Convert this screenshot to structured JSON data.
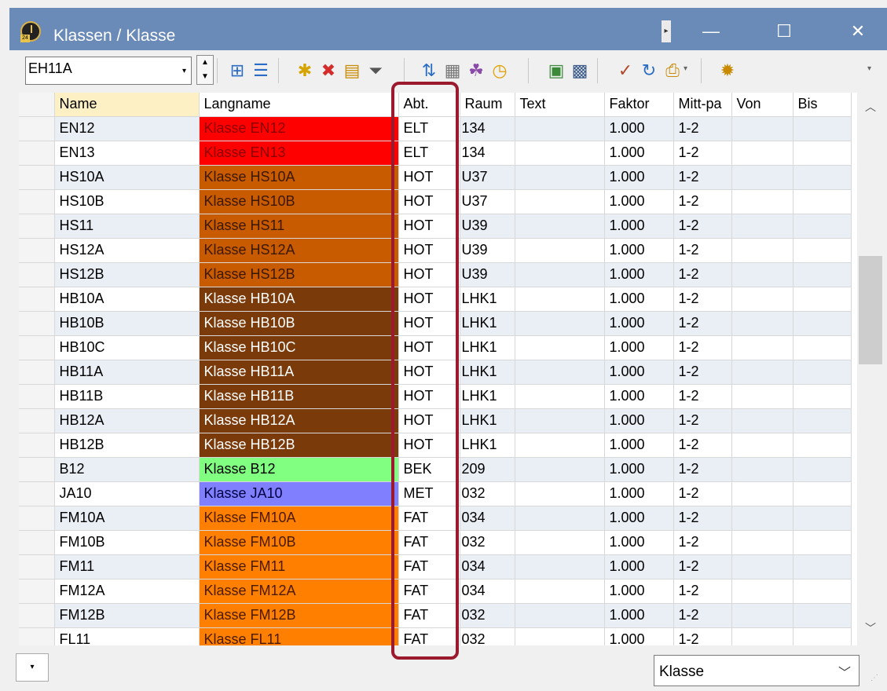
{
  "window": {
    "title": "Klassen / Klasse",
    "pin_glyph": "▸",
    "minimize_glyph": "—",
    "maximize_glyph": "☐",
    "close_glyph": "✕"
  },
  "toolbar": {
    "class_selector_value": "EH11A",
    "combo_arrow": "▾",
    "spin_up": "▲",
    "spin_down": "▼",
    "icons": [
      {
        "name": "grid-settings-icon",
        "glyph": "⊞",
        "color": "#2b6cc4"
      },
      {
        "name": "list-view-icon",
        "glyph": "☰",
        "color": "#2b6cc4"
      },
      {
        "name": "new-record-icon",
        "glyph": "✱",
        "color": "#d6a400"
      },
      {
        "name": "delete-icon",
        "glyph": "✖",
        "color": "#d42b2b"
      },
      {
        "name": "report-icon",
        "glyph": "▤",
        "color": "#c98a00"
      },
      {
        "name": "filter-icon",
        "glyph": "⏷",
        "color": "#555555"
      },
      {
        "name": "sort-icon",
        "glyph": "⇅",
        "color": "#2b6cc4"
      },
      {
        "name": "field-layout-icon",
        "glyph": "▦",
        "color": "#777777"
      },
      {
        "name": "teams-icon",
        "glyph": "☘",
        "color": "#8a4aa8"
      },
      {
        "name": "time-request-icon",
        "glyph": "◷",
        "color": "#e0a000"
      },
      {
        "name": "copy-icon",
        "glyph": "▣",
        "color": "#3a8a3a"
      },
      {
        "name": "calendar-icon",
        "glyph": "▩",
        "color": "#3a5a8a"
      },
      {
        "name": "plan-check-icon",
        "glyph": "✓",
        "color": "#b04a2a"
      },
      {
        "name": "refresh-icon",
        "glyph": "↻",
        "color": "#2b6cc4"
      },
      {
        "name": "print-settings-icon",
        "glyph": "⎙",
        "color": "#c98a00"
      },
      {
        "name": "settings-icon",
        "glyph": "✹",
        "color": "#c98a00"
      }
    ],
    "overflow_glyph": "▾"
  },
  "grid": {
    "columns": [
      "Name",
      "Langname",
      "Abt.",
      "Raum",
      "Text",
      "Faktor",
      "Mitt-pa",
      "Von",
      "Bis"
    ],
    "rows": [
      {
        "name": "EN12",
        "langname": "Klasse EN12",
        "color": "#ff0000",
        "text_color": "#8a0000",
        "abt": "ELT",
        "raum": "134",
        "text": "",
        "faktor": "1.000",
        "mittpa": "1-2",
        "von": "",
        "bis": ""
      },
      {
        "name": "EN13",
        "langname": "Klasse EN13",
        "color": "#ff0000",
        "text_color": "#8a0000",
        "abt": "ELT",
        "raum": "134",
        "text": "",
        "faktor": "1.000",
        "mittpa": "1-2",
        "von": "",
        "bis": ""
      },
      {
        "name": "HS10A",
        "langname": "Klasse HS10A",
        "color": "#c85a00",
        "text_color": "#3a1800",
        "abt": "HOT",
        "raum": "U37",
        "text": "",
        "faktor": "1.000",
        "mittpa": "1-2",
        "von": "",
        "bis": ""
      },
      {
        "name": "HS10B",
        "langname": "Klasse HS10B",
        "color": "#c85a00",
        "text_color": "#3a1800",
        "abt": "HOT",
        "raum": "U37",
        "text": "",
        "faktor": "1.000",
        "mittpa": "1-2",
        "von": "",
        "bis": ""
      },
      {
        "name": "HS11",
        "langname": "Klasse HS11",
        "color": "#c85a00",
        "text_color": "#3a1800",
        "abt": "HOT",
        "raum": "U39",
        "text": "",
        "faktor": "1.000",
        "mittpa": "1-2",
        "von": "",
        "bis": ""
      },
      {
        "name": "HS12A",
        "langname": "Klasse HS12A",
        "color": "#c85a00",
        "text_color": "#3a1800",
        "abt": "HOT",
        "raum": "U39",
        "text": "",
        "faktor": "1.000",
        "mittpa": "1-2",
        "von": "",
        "bis": ""
      },
      {
        "name": "HS12B",
        "langname": "Klasse HS12B",
        "color": "#c85a00",
        "text_color": "#3a1800",
        "abt": "HOT",
        "raum": "U39",
        "text": "",
        "faktor": "1.000",
        "mittpa": "1-2",
        "von": "",
        "bis": ""
      },
      {
        "name": "HB10A",
        "langname": "Klasse HB10A",
        "color": "#7a3a0a",
        "text_color": "#ffffff",
        "abt": "HOT",
        "raum": "LHK1",
        "text": "",
        "faktor": "1.000",
        "mittpa": "1-2",
        "von": "",
        "bis": ""
      },
      {
        "name": "HB10B",
        "langname": "Klasse HB10B",
        "color": "#7a3a0a",
        "text_color": "#ffffff",
        "abt": "HOT",
        "raum": "LHK1",
        "text": "",
        "faktor": "1.000",
        "mittpa": "1-2",
        "von": "",
        "bis": ""
      },
      {
        "name": "HB10C",
        "langname": "Klasse HB10C",
        "color": "#7a3a0a",
        "text_color": "#ffffff",
        "abt": "HOT",
        "raum": "LHK1",
        "text": "",
        "faktor": "1.000",
        "mittpa": "1-2",
        "von": "",
        "bis": ""
      },
      {
        "name": "HB11A",
        "langname": "Klasse HB11A",
        "color": "#7a3a0a",
        "text_color": "#ffffff",
        "abt": "HOT",
        "raum": "LHK1",
        "text": "",
        "faktor": "1.000",
        "mittpa": "1-2",
        "von": "",
        "bis": ""
      },
      {
        "name": "HB11B",
        "langname": "Klasse HB11B",
        "color": "#7a3a0a",
        "text_color": "#ffffff",
        "abt": "HOT",
        "raum": "LHK1",
        "text": "",
        "faktor": "1.000",
        "mittpa": "1-2",
        "von": "",
        "bis": ""
      },
      {
        "name": "HB12A",
        "langname": "Klasse HB12A",
        "color": "#7a3a0a",
        "text_color": "#ffffff",
        "abt": "HOT",
        "raum": "LHK1",
        "text": "",
        "faktor": "1.000",
        "mittpa": "1-2",
        "von": "",
        "bis": ""
      },
      {
        "name": "HB12B",
        "langname": "Klasse HB12B",
        "color": "#7a3a0a",
        "text_color": "#ffffff",
        "abt": "HOT",
        "raum": "LHK1",
        "text": "",
        "faktor": "1.000",
        "mittpa": "1-2",
        "von": "",
        "bis": ""
      },
      {
        "name": "B12",
        "langname": "Klasse B12",
        "color": "#80ff80",
        "text_color": "#000000",
        "abt": "BEK",
        "raum": "209",
        "text": "",
        "faktor": "1.000",
        "mittpa": "1-2",
        "von": "",
        "bis": ""
      },
      {
        "name": "JA10",
        "langname": "Klasse JA10",
        "color": "#8080ff",
        "text_color": "#000040",
        "abt": "MET",
        "raum": "032",
        "text": "",
        "faktor": "1.000",
        "mittpa": "1-2",
        "von": "",
        "bis": ""
      },
      {
        "name": "FM10A",
        "langname": "Klasse FM10A",
        "color": "#ff8000",
        "text_color": "#4a1a00",
        "abt": "FAT",
        "raum": "034",
        "text": "",
        "faktor": "1.000",
        "mittpa": "1-2",
        "von": "",
        "bis": ""
      },
      {
        "name": "FM10B",
        "langname": "Klasse FM10B",
        "color": "#ff8000",
        "text_color": "#4a1a00",
        "abt": "FAT",
        "raum": "032",
        "text": "",
        "faktor": "1.000",
        "mittpa": "1-2",
        "von": "",
        "bis": ""
      },
      {
        "name": "FM11",
        "langname": "Klasse FM11",
        "color": "#ff8000",
        "text_color": "#4a1a00",
        "abt": "FAT",
        "raum": "034",
        "text": "",
        "faktor": "1.000",
        "mittpa": "1-2",
        "von": "",
        "bis": ""
      },
      {
        "name": "FM12A",
        "langname": "Klasse FM12A",
        "color": "#ff8000",
        "text_color": "#4a1a00",
        "abt": "FAT",
        "raum": "034",
        "text": "",
        "faktor": "1.000",
        "mittpa": "1-2",
        "von": "",
        "bis": ""
      },
      {
        "name": "FM12B",
        "langname": "Klasse FM12B",
        "color": "#ff8000",
        "text_color": "#4a1a00",
        "abt": "FAT",
        "raum": "032",
        "text": "",
        "faktor": "1.000",
        "mittpa": "1-2",
        "von": "",
        "bis": ""
      },
      {
        "name": "FL11",
        "langname": "Klasse FL11",
        "color": "#ff8000",
        "text_color": "#4a1a00",
        "abt": "FAT",
        "raum": "032",
        "text": "",
        "faktor": "1.000",
        "mittpa": "1-2",
        "von": "",
        "bis": ""
      }
    ],
    "highlight_color": "#9b1a2e"
  },
  "scrollbar": {
    "up_glyph": "︿",
    "down_glyph": "﹀"
  },
  "bottom": {
    "left_button_glyph": "▾",
    "view_select_value": "Klasse",
    "view_select_arrow": "﹀",
    "grip_glyph": "⋰"
  }
}
